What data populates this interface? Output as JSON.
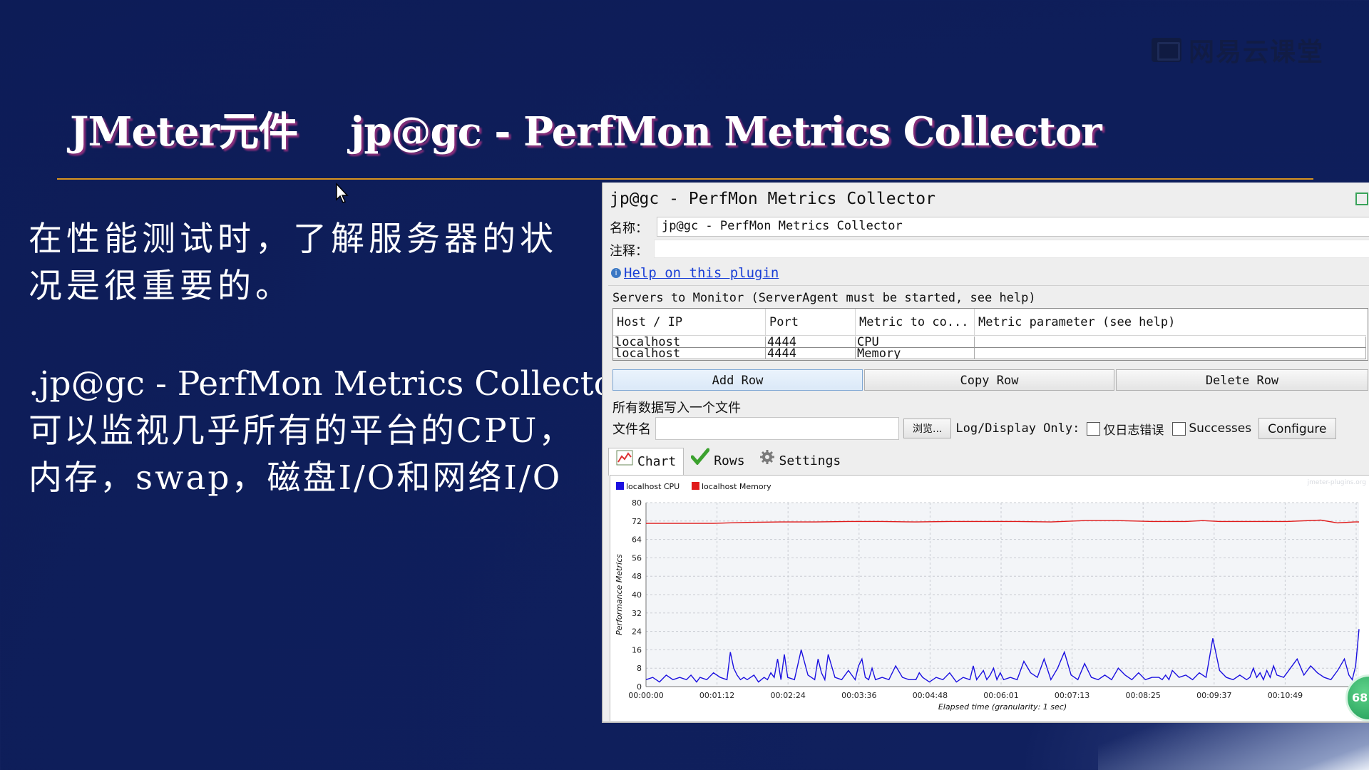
{
  "brand": "网易云课堂",
  "slide": {
    "title": "JMeter元件    jp@gc - PerfMon Metrics Collector",
    "para1": [
      "在性能测试时，了解服务器的状",
      "况是很重要的。"
    ],
    "para2": [
      ".jp@gc - PerfMon Metrics Collector",
      "可以监视几乎所有的平台的CPU，",
      "内存，swap，磁盘I/O和网络I/O"
    ]
  },
  "panel": {
    "title": "jp@gc - PerfMon Metrics Collector",
    "name_label": "名称：",
    "name_value": "jp@gc - PerfMon Metrics Collector",
    "comment_label": "注释：",
    "comment_value": "",
    "help_link": "Help on this plugin",
    "servers_legend": "Servers to Monitor (ServerAgent must be started, see help)",
    "table": {
      "headers": [
        "Host / IP",
        "Port",
        "Metric to co...",
        "Metric parameter (see help)"
      ],
      "rows": [
        [
          "localhost",
          "4444",
          "CPU",
          ""
        ],
        [
          "localhost",
          "4444",
          "Memory",
          ""
        ]
      ]
    },
    "buttons": {
      "add_row": "Add Row",
      "copy_row": "Copy Row",
      "delete_row": "Delete Row"
    },
    "file_legend": "所有数据写入一个文件",
    "file_label": "文件名",
    "file_value": "",
    "browse_label": "浏览...",
    "log_display_label": "Log/Display Only:",
    "errors_only_label": "仅日志错误",
    "successes_label": "Successes",
    "configure_label": "Configure",
    "tabs": [
      "Chart",
      "Rows",
      "Settings"
    ],
    "badge": "68"
  },
  "colors": {
    "cpu": "#1b10e0",
    "memory": "#e01b1b",
    "title_rule": "#d9941f"
  },
  "chart_data": {
    "type": "line",
    "watermark": "jmeter-plugins.org",
    "ylabel": "Performance Metrics",
    "xlabel": "Elapsed time (granularity: 1 sec)",
    "ylim": [
      0,
      80
    ],
    "yticks": [
      0,
      8,
      16,
      24,
      32,
      40,
      48,
      56,
      64,
      72,
      80
    ],
    "xticks": [
      "00:00:00",
      "00:01:12",
      "00:02:24",
      "00:03:36",
      "00:04:48",
      "00:06:01",
      "00:07:13",
      "00:08:25",
      "00:09:37",
      "00:10:49",
      "00:1"
    ],
    "series": [
      {
        "name": "localhost CPU",
        "color": "#1b10e0",
        "x_sec": [
          0,
          12,
          24,
          36,
          48,
          60,
          72,
          80,
          90,
          96,
          108,
          120,
          132,
          144,
          150,
          156,
          162,
          168,
          174,
          180,
          192,
          200,
          210,
          216,
          222,
          228,
          234,
          240,
          246,
          252,
          264,
          276,
          288,
          300,
          306,
          312,
          318,
          324,
          336,
          348,
          360,
          366,
          372,
          378,
          384,
          390,
          396,
          402,
          408,
          420,
          432,
          444,
          456,
          468,
          480,
          486,
          492,
          498,
          504,
          516,
          528,
          540,
          552,
          564,
          576,
          582,
          588,
          594,
          600,
          606,
          612,
          618,
          624,
          630,
          636,
          648,
          660,
          672,
          684,
          696,
          708,
          720,
          732,
          744,
          756,
          768,
          780,
          792,
          804,
          816,
          828,
          840,
          852,
          864,
          876,
          888,
          900,
          912,
          918,
          924,
          930,
          936,
          948,
          960,
          972,
          984,
          996,
          1008,
          1020,
          1032,
          1044,
          1056,
          1062,
          1068,
          1074,
          1080,
          1086,
          1092,
          1098,
          1104,
          1110,
          1116,
          1122,
          1134,
          1146,
          1158,
          1170,
          1182,
          1194,
          1206,
          1218,
          1230,
          1242,
          1250,
          1256,
          1262,
          1268
        ],
        "values": [
          3,
          4,
          2,
          5,
          3,
          4,
          3,
          5,
          2,
          4,
          3,
          6,
          4,
          3,
          15,
          8,
          5,
          3,
          4,
          3,
          5,
          2,
          4,
          3,
          6,
          4,
          12,
          3,
          14,
          4,
          3,
          16,
          5,
          3,
          12,
          6,
          3,
          14,
          4,
          3,
          7,
          5,
          3,
          9,
          12,
          4,
          3,
          8,
          3,
          4,
          3,
          9,
          4,
          3,
          3,
          6,
          4,
          3,
          2,
          4,
          3,
          6,
          2,
          4,
          3,
          9,
          3,
          5,
          7,
          3,
          5,
          8,
          3,
          6,
          3,
          4,
          3,
          11,
          6,
          4,
          12,
          3,
          8,
          15,
          5,
          3,
          10,
          4,
          3,
          5,
          3,
          8,
          5,
          3,
          6,
          3,
          4,
          4,
          3,
          5,
          3,
          7,
          4,
          5,
          3,
          6,
          4,
          21,
          7,
          4,
          3,
          5,
          4,
          3,
          4,
          8,
          4,
          6,
          3,
          7,
          4,
          9,
          5,
          4,
          8,
          12,
          5,
          9,
          6,
          4,
          3,
          7,
          12,
          5,
          3,
          9,
          25
        ]
      },
      {
        "name": "localhost Memory",
        "color": "#e01b1b",
        "x_sec": [
          0,
          60,
          120,
          180,
          240,
          300,
          360,
          420,
          480,
          540,
          600,
          660,
          720,
          780,
          840,
          900,
          960,
          990,
          1020,
          1080,
          1140,
          1200,
          1230,
          1260,
          1268
        ],
        "values": [
          71,
          71,
          71,
          71.4,
          71.6,
          71.6,
          71.8,
          71.8,
          71.6,
          71.8,
          71.8,
          71.8,
          71.6,
          72.2,
          72.2,
          71.8,
          71.8,
          72.2,
          71.8,
          71.8,
          71.8,
          72.4,
          71.2,
          71.6,
          71.6
        ]
      }
    ]
  }
}
